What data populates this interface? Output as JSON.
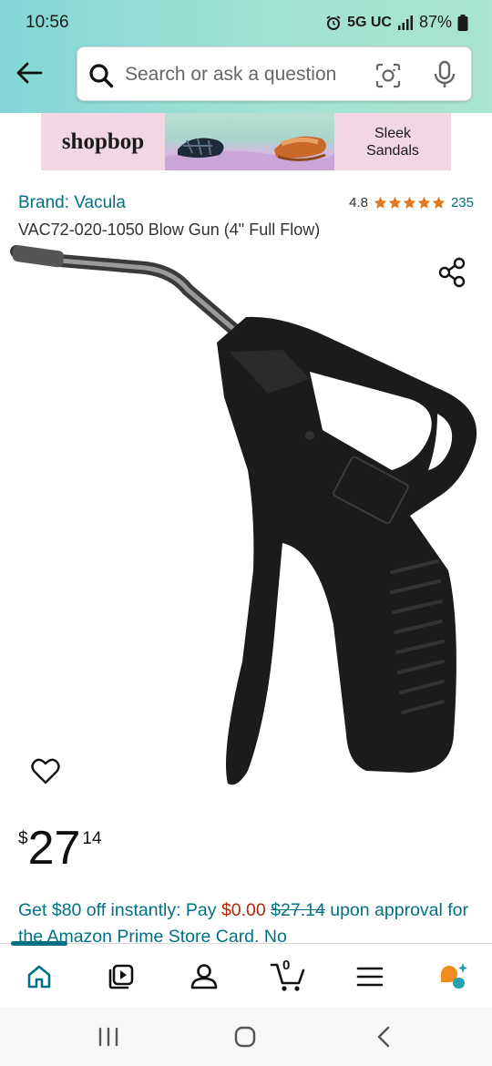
{
  "status_bar": {
    "time": "10:56",
    "network": "5G UC",
    "battery": "87%"
  },
  "search": {
    "placeholder": "Search or ask a question",
    "value": ""
  },
  "ad": {
    "brand": "shopbop",
    "tagline_line1": "Sleek",
    "tagline_line2": "Sandals"
  },
  "product": {
    "brand": "Brand: Vacula",
    "rating": "4.8",
    "stars": 5,
    "rating_count": "235",
    "title": "VAC72-020-1050 Blow Gun (4\" Full Flow)"
  },
  "price": {
    "symbol": "$",
    "whole": "27",
    "fraction": "14"
  },
  "promo": {
    "part1": "Get $80 off instantly: Pay ",
    "new_price": "$0.00",
    "old_price": "$27.14",
    "part2": " upon approval for the Amazon Prime Store Card. No"
  },
  "bottom_nav": {
    "cart_count": "0",
    "active": "home"
  },
  "colors": {
    "link": "#007185",
    "price_red": "#b12704",
    "star": "#de7921",
    "header_start": "#83d6d8",
    "header_end": "#a9e5cf"
  },
  "icons": [
    "back-arrow-icon",
    "search-icon",
    "camera-icon",
    "mic-icon",
    "share-icon",
    "heart-icon",
    "home-icon",
    "video-icon",
    "account-icon",
    "cart-icon",
    "menu-icon",
    "rufus-icon"
  ]
}
